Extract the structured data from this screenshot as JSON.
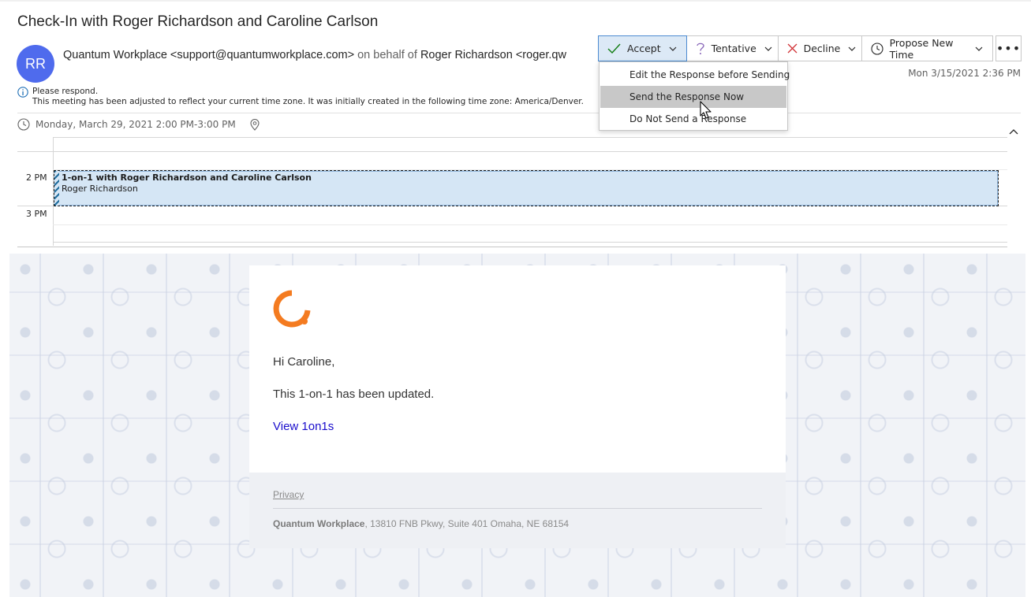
{
  "message": {
    "subject": "Check-In with Roger Richardson and Caroline Carlson",
    "avatar_initials": "RR",
    "sender_name": "Quantum Workplace <support@quantumworkplace.com>",
    "on_behalf_of": "on behalf of",
    "delegate": "Roger Richardson <roger.qw",
    "sent": "Mon 3/15/2021 2:36 PM",
    "info_line1": "Please respond.",
    "info_line2": "This meeting has been adjusted to reflect your current time zone. It was initially created in the following time zone: America/Denver.",
    "when": "Monday, March 29, 2021 2:00 PM-3:00 PM"
  },
  "actions": {
    "accept": "Accept",
    "tentative": "Tentative",
    "decline": "Decline",
    "propose": "Propose New Time",
    "more": "•••"
  },
  "menu": {
    "items": [
      {
        "text": "Edit the Response before Sending"
      },
      {
        "text": "Send the Response Now"
      },
      {
        "text": "Do Not Send a Response"
      }
    ],
    "hovered_index": 1
  },
  "calendar": {
    "hour_2": "2 PM",
    "hour_3": "3 PM",
    "event_title": "1-on-1 with Roger Richardson and Caroline Carlson",
    "event_organizer": "Roger Richardson"
  },
  "email": {
    "greeting": "Hi Caroline,",
    "message": "This 1-on-1 has been updated.",
    "link": "View 1on1s",
    "privacy": "Privacy",
    "company": "Quantum Workplace",
    "address": ", 13810 FNB Pkwy, Suite 401 Omaha, NE 68154"
  },
  "colors": {
    "accent": "#4f6bed",
    "brand_orange": "#f47b20",
    "link": "#1a0dcc",
    "decline_red": "#d13438",
    "tentative_purple": "#8764b8",
    "accept_green": "#107c10"
  },
  "icons": [
    "check-icon",
    "question-icon",
    "x-icon",
    "clock-icon",
    "info-icon",
    "location-pin-icon",
    "chevron-up-icon",
    "chevron-down-icon",
    "mouse-cursor-icon",
    "quantum-logo"
  ]
}
